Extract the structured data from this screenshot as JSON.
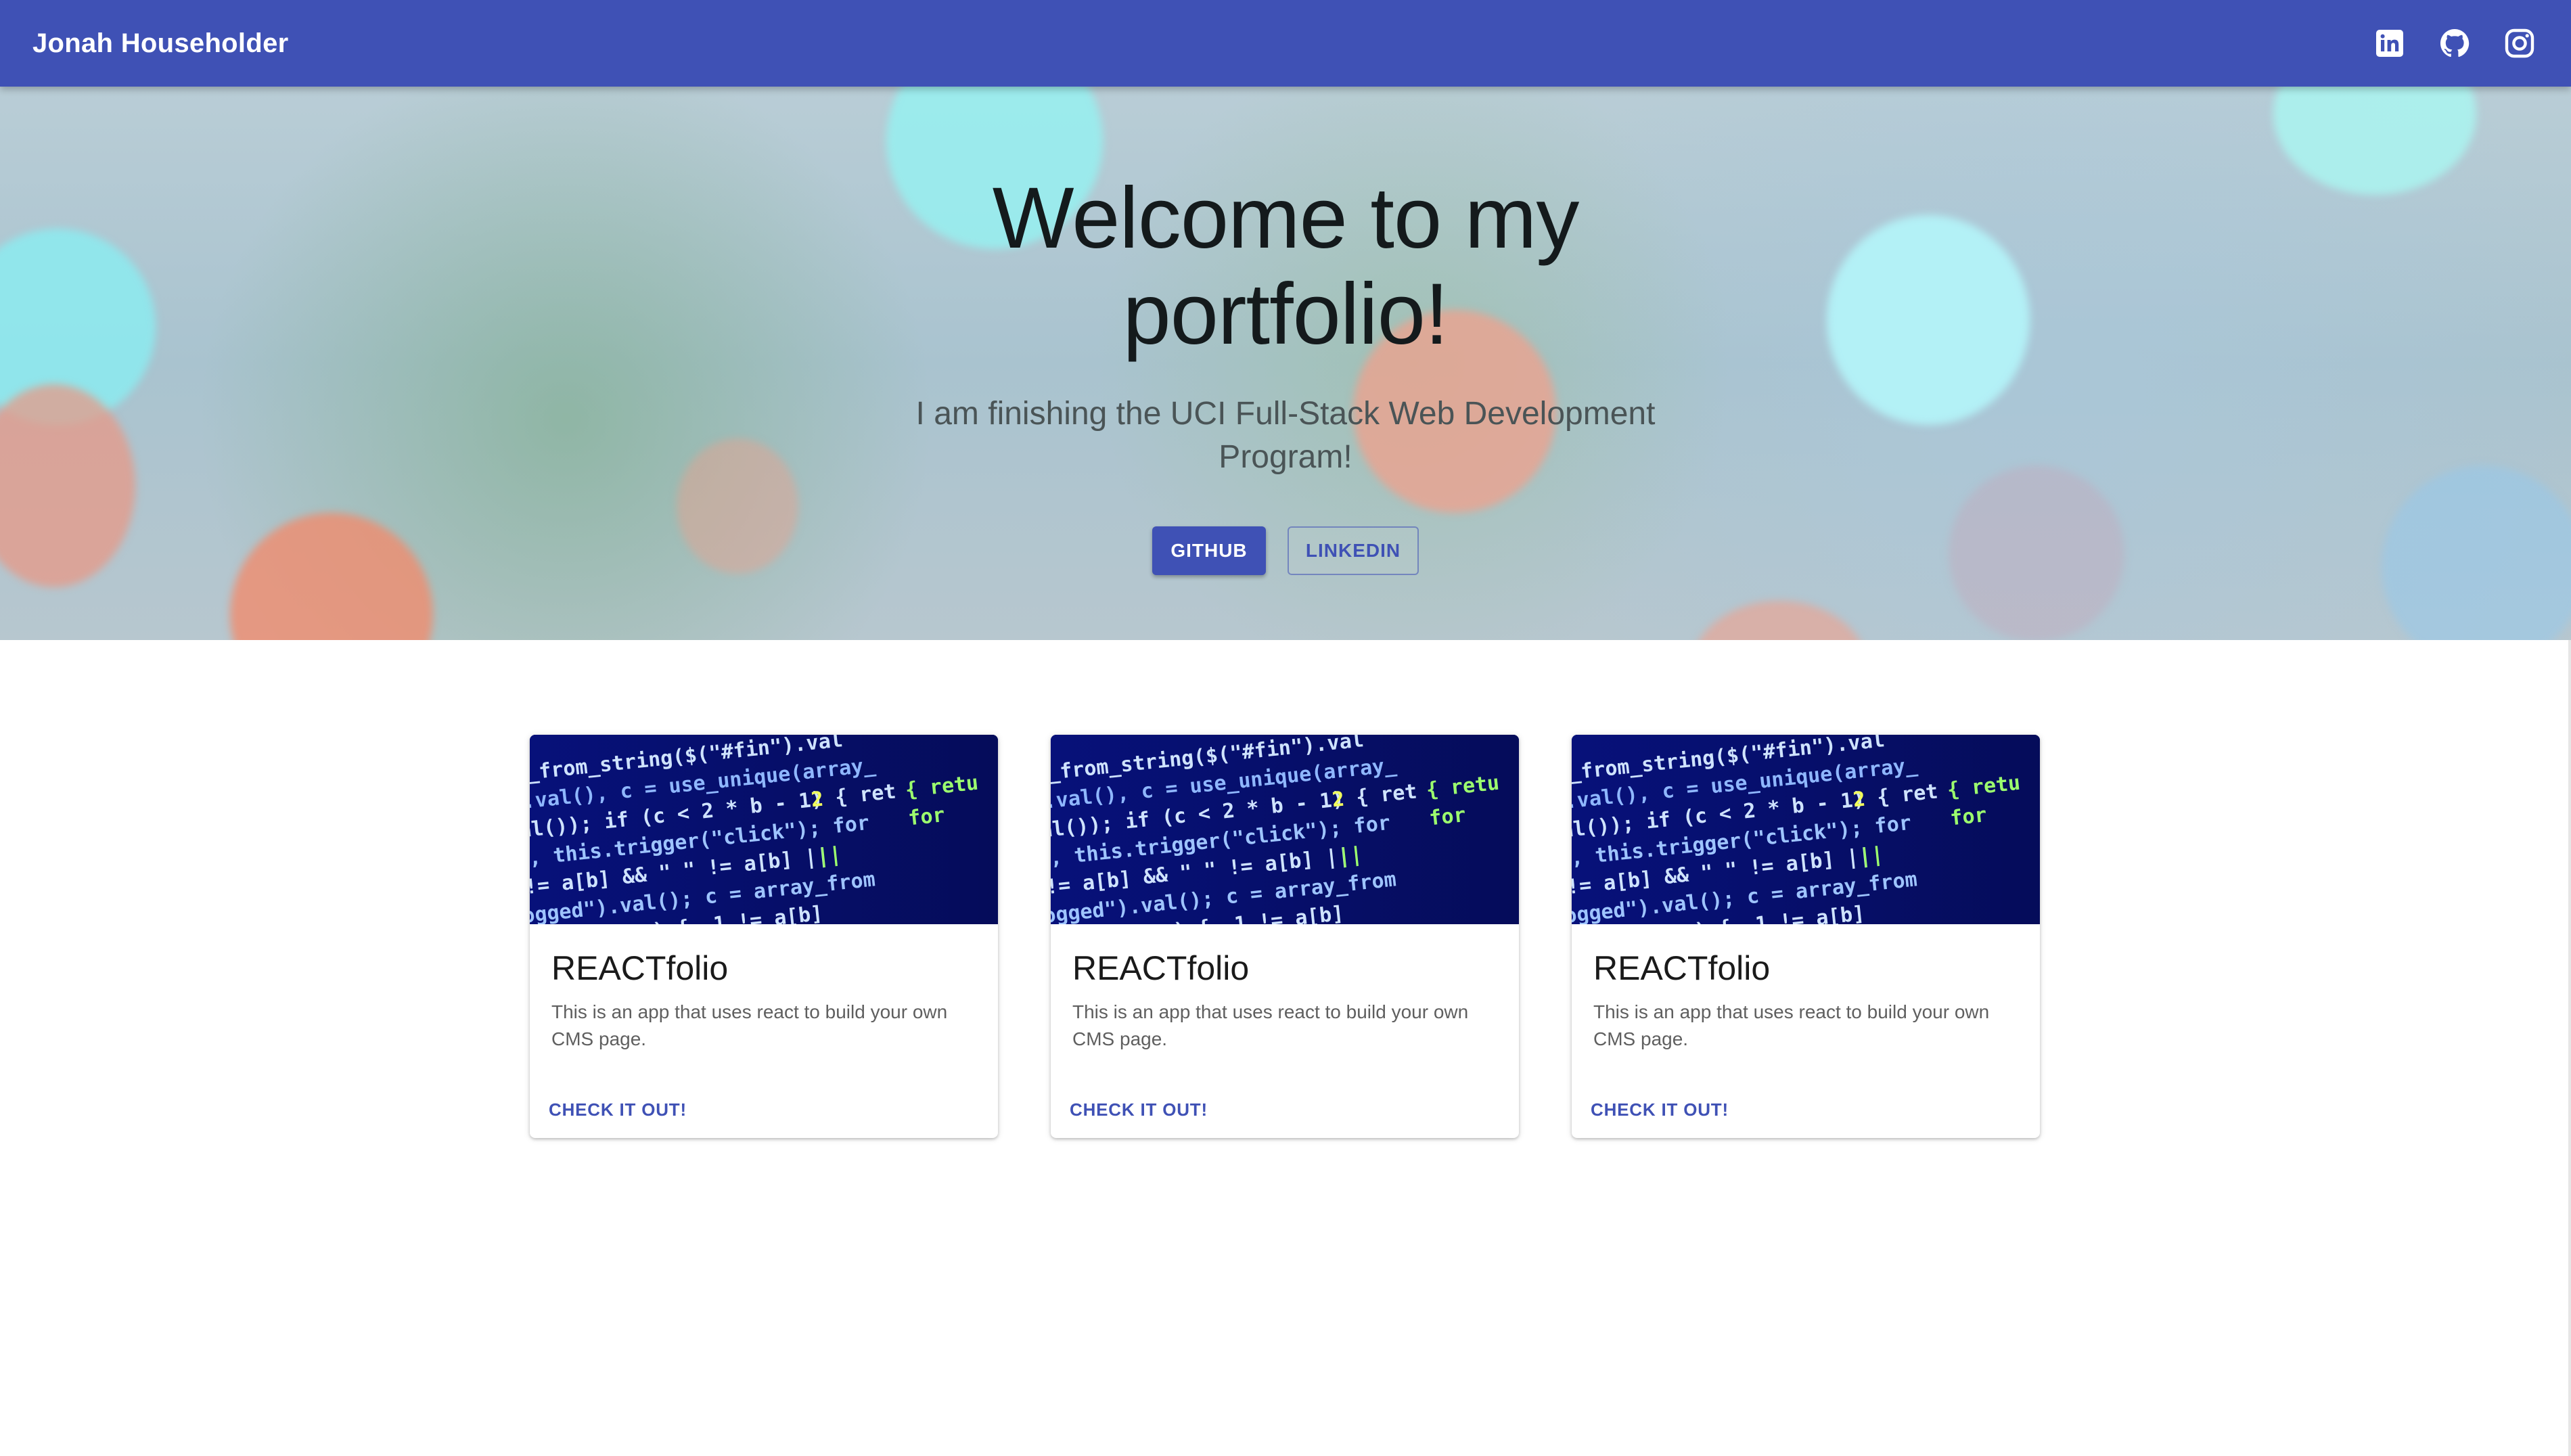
{
  "header": {
    "brand": "Jonah Householder",
    "icons": [
      "linkedin-icon",
      "github-icon",
      "instagram-icon"
    ]
  },
  "hero": {
    "title": "Welcome to my portfolio!",
    "subtitle": "I am finishing the UCI Full-Stack Web Development Program!",
    "buttons": {
      "primary": "GITHUB",
      "secondary": "LINKEDIN"
    }
  },
  "cards": [
    {
      "title": "REACTfolio",
      "description": "This is an app that uses react to build your own CMS page.",
      "action": "CHECK IT OUT!"
    },
    {
      "title": "REACTfolio",
      "description": "This is an app that uses react to build your own CMS page.",
      "action": "CHECK IT OUT!"
    },
    {
      "title": "REACTfolio",
      "description": "This is an app that uses react to build your own CMS page.",
      "action": "CHECK IT OUT!"
    }
  ],
  "colors": {
    "primary": "#3f51b5",
    "text_dark": "#141a1c",
    "text_muted": "#5f5f5f"
  }
}
